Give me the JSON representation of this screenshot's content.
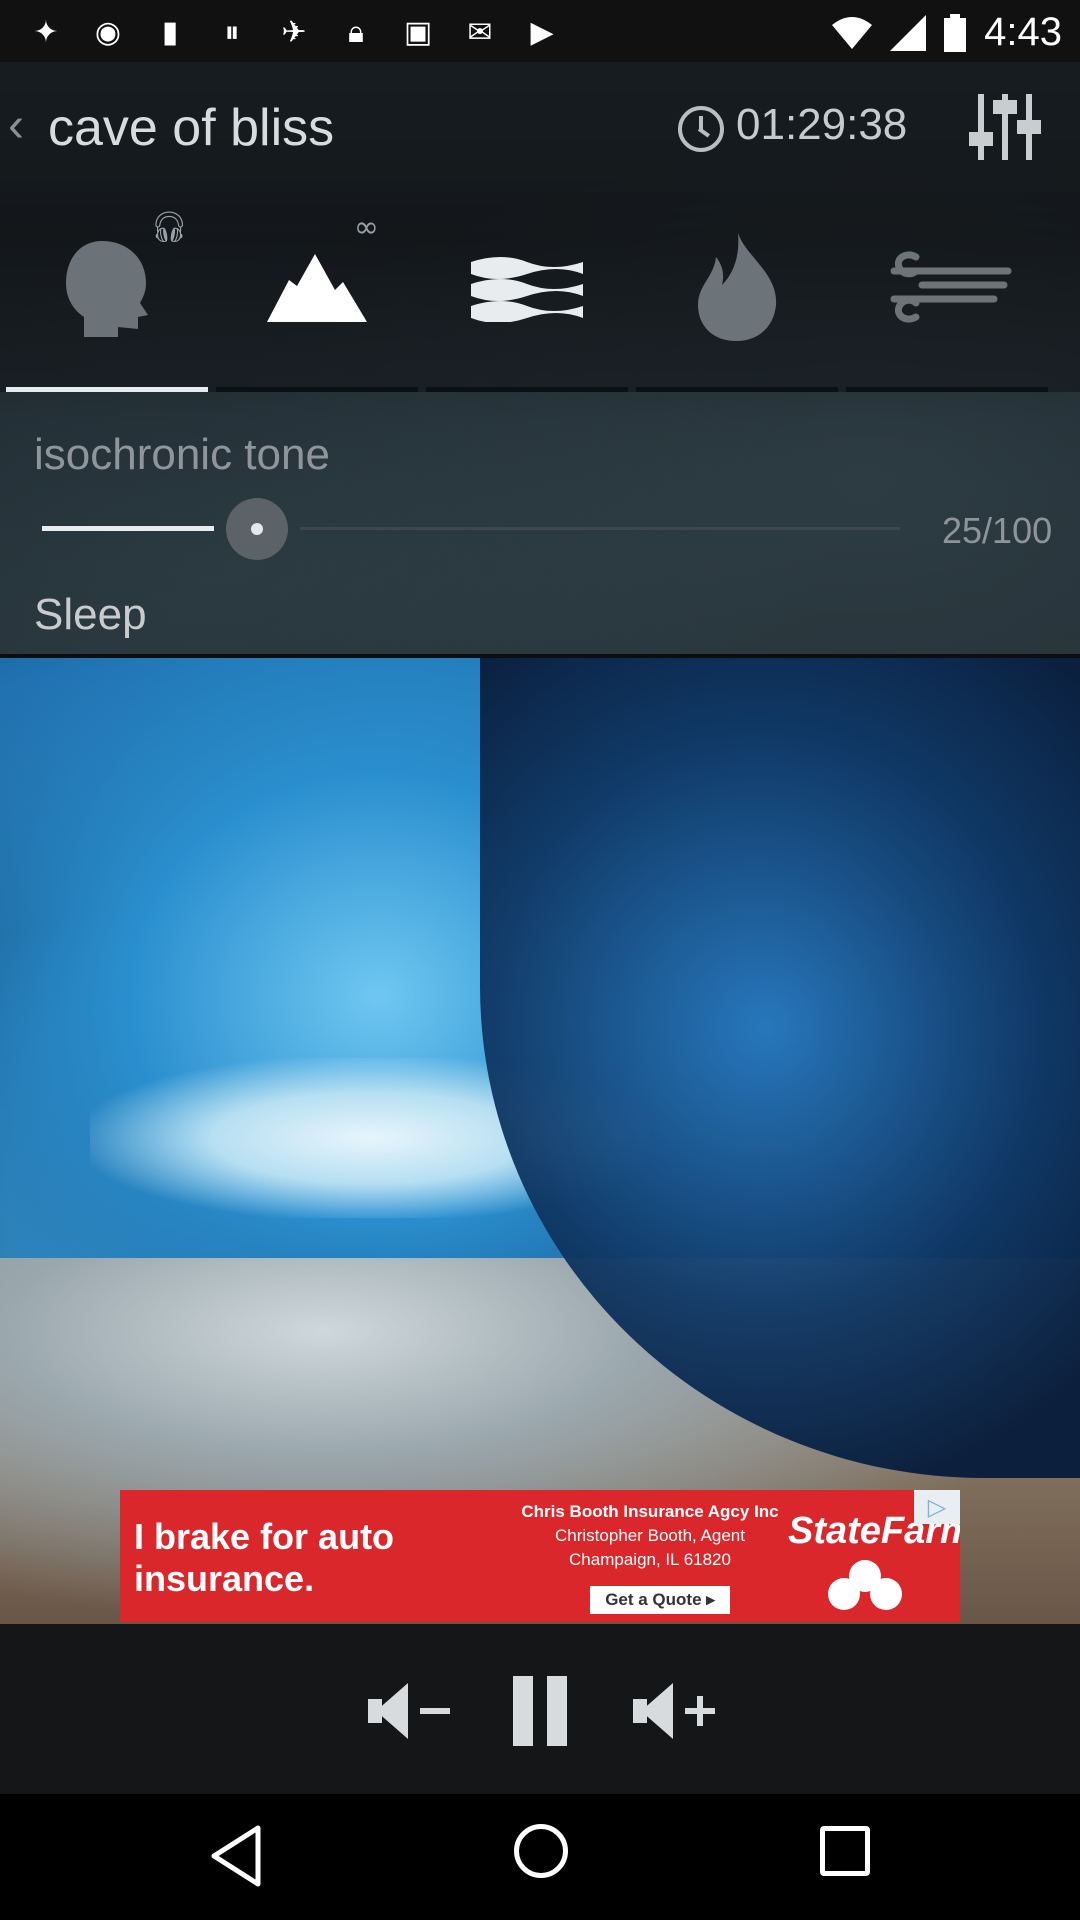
{
  "status_bar": {
    "time": "4:43",
    "left_icons": [
      "notification-icon",
      "app-icon",
      "ifttt-icon",
      "pause-circle-icon",
      "fake-gps-icon",
      "lock-icon",
      "game-icon",
      "check-mail-icon",
      "play-store-icon"
    ],
    "right_icons": [
      "wifi-icon",
      "signal-icon",
      "battery-icon"
    ]
  },
  "header": {
    "back_glyph": "‹",
    "title": "cave of bliss",
    "timer": "01:29:38"
  },
  "sound_tabs": [
    {
      "name": "head-icon",
      "badge": "headphones",
      "active": true
    },
    {
      "name": "mountain-icon",
      "badge": "∞",
      "active": false
    },
    {
      "name": "waves-icon",
      "badge": "",
      "active": false
    },
    {
      "name": "fire-icon",
      "badge": "",
      "active": false
    },
    {
      "name": "wind-icon",
      "badge": "",
      "active": false
    }
  ],
  "tone": {
    "label": "isochronic tone",
    "value_text": "25/100",
    "value": 25,
    "max": 100,
    "preset": "Sleep"
  },
  "ad": {
    "headline": "I brake for auto insurance.",
    "agent_line1": "Chris Booth Insurance Agcy Inc",
    "agent_line2": "Christopher Booth, Agent",
    "agent_line3": "Champaign, IL 61820",
    "cta": "Get a Quote ▸",
    "brand": "StateFarm",
    "choice_icon": "adchoices-icon",
    "colors": {
      "background": "#d9272c",
      "text": "#ffffff"
    }
  },
  "controls": {
    "icons": [
      "volume-down-icon",
      "pause-icon",
      "volume-up-icon"
    ]
  },
  "navbar": {
    "icons": [
      "back-nav-icon",
      "home-nav-icon",
      "recents-nav-icon"
    ]
  }
}
